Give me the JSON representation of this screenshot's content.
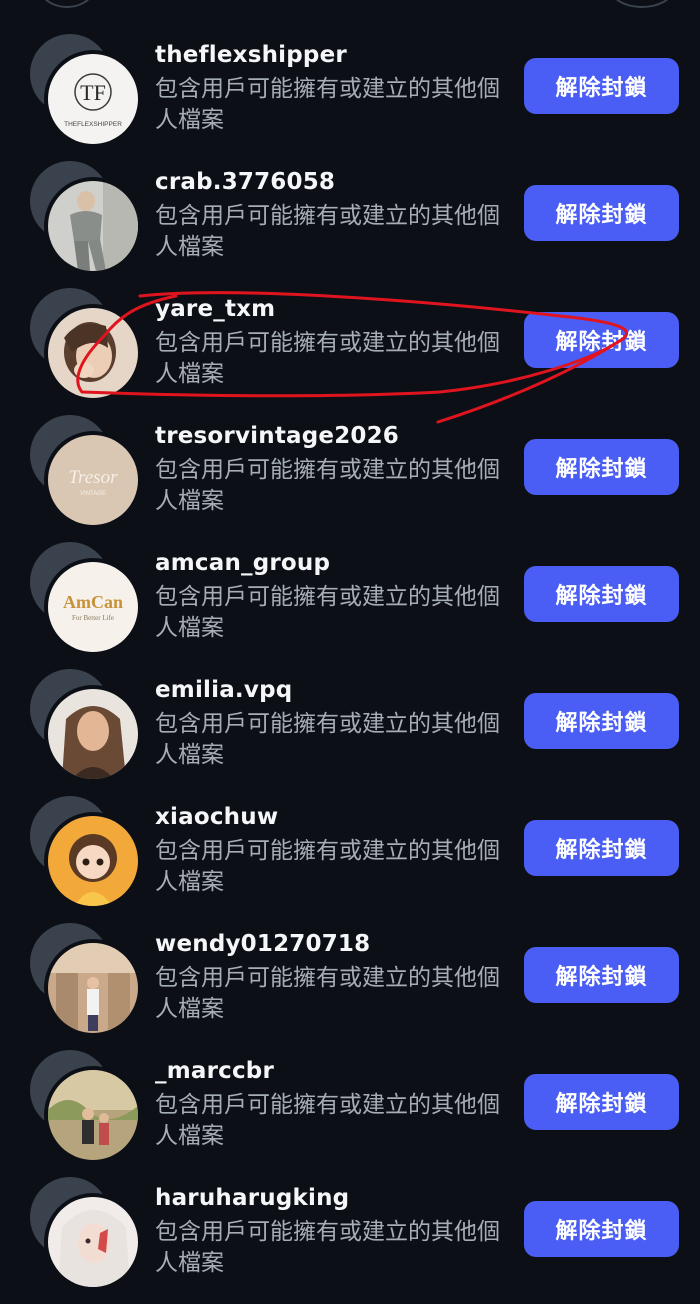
{
  "blocked_list": {
    "subtitle": "包含用戶可能擁有或建立的其他個人檔案",
    "button_label": "解除封鎖",
    "accent_color": "#4a5ef5",
    "annotation_color": "#e0141e",
    "users": [
      {
        "username": "theflexshipper",
        "avatar_icon": "theflexshipper-logo-avatar"
      },
      {
        "username": "crab.3776058",
        "avatar_icon": "photo-avatar"
      },
      {
        "username": "yare_txm",
        "avatar_icon": "photo-avatar"
      },
      {
        "username": "tresorvintage2026",
        "avatar_icon": "tresor-logo-avatar"
      },
      {
        "username": "amcan_group",
        "avatar_icon": "amcan-logo-avatar"
      },
      {
        "username": "emilia.vpq",
        "avatar_icon": "photo-avatar"
      },
      {
        "username": "xiaochuw",
        "avatar_icon": "cartoon-avatar"
      },
      {
        "username": "wendy01270718",
        "avatar_icon": "photo-avatar"
      },
      {
        "username": "_marccbr",
        "avatar_icon": "photo-avatar"
      },
      {
        "username": "haruharugking",
        "avatar_icon": "photo-avatar"
      }
    ]
  },
  "avatars": {
    "theflexshipper_logo": "TF",
    "theflexshipper_wordmark": "THEFLEXSHIPPER",
    "tresor_logo": "Tresor",
    "tresor_sub": "VINTAGE",
    "amcan_logo": "AmCan",
    "amcan_tagline": "For Better Life"
  }
}
